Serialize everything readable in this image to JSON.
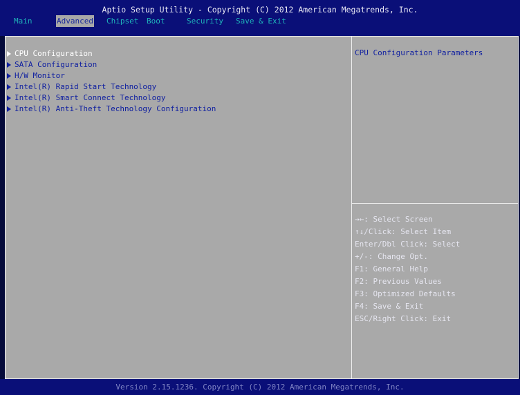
{
  "header": {
    "title": "Aptio Setup Utility - Copyright (C) 2012 American Megatrends, Inc.",
    "tabs": [
      {
        "label": "Main",
        "active": false
      },
      {
        "label": "Advanced",
        "active": true
      },
      {
        "label": "Chipset",
        "active": false
      },
      {
        "label": "Boot",
        "active": false
      },
      {
        "label": "Security",
        "active": false
      },
      {
        "label": "Save & Exit",
        "active": false
      }
    ]
  },
  "main": {
    "items": [
      {
        "label": "CPU Configuration",
        "selected": true,
        "icon": "submenu-arrow-icon"
      },
      {
        "label": "SATA Configuration",
        "selected": false,
        "icon": "submenu-arrow-icon"
      },
      {
        "label": "H/W Monitor",
        "selected": false,
        "icon": "submenu-arrow-icon"
      },
      {
        "label": "Intel(R) Rapid Start Technology",
        "selected": false,
        "icon": "submenu-arrow-icon"
      },
      {
        "label": "Intel(R) Smart Connect Technology",
        "selected": false,
        "icon": "submenu-arrow-icon"
      },
      {
        "label": "Intel(R) Anti-Theft Technology Configuration",
        "selected": false,
        "icon": "submenu-arrow-icon"
      }
    ]
  },
  "help": {
    "description": "CPU Configuration Parameters",
    "keys": [
      "→←: Select Screen",
      "↑↓/Click: Select Item",
      "Enter/Dbl Click: Select",
      "+/-: Change Opt.",
      "F1: General Help",
      "F2: Previous Values",
      "F3: Optimized Defaults",
      "F4: Save & Exit",
      "ESC/Right Click: Exit"
    ]
  },
  "footer": {
    "text": "Version 2.15.1236. Copyright (C) 2012 American Megatrends, Inc."
  },
  "colors": {
    "header_bg": "#0a0f78",
    "panel_bg": "#a9a9a9",
    "tab_text": "#1fb4ba",
    "item_text": "#1020a0",
    "selected_text": "#ffffff",
    "footer_text": "#7f84c4"
  }
}
